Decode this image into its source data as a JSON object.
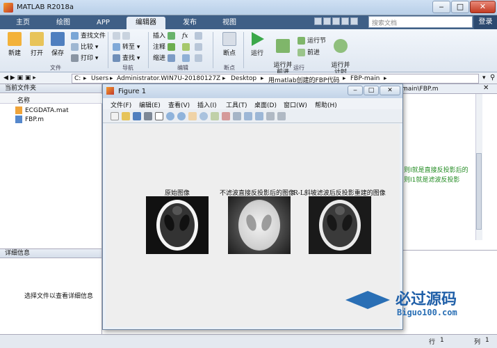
{
  "window": {
    "title": "MATLAB R2018a"
  },
  "tabs": [
    "主页",
    "绘图",
    "APP",
    "编辑器",
    "发布",
    "视图"
  ],
  "active_tab": "编辑器",
  "search": {
    "placeholder": "搜索文档"
  },
  "login_label": "登录",
  "ribbon": {
    "file": {
      "new": "新建",
      "open": "打开",
      "save": "保存",
      "find_files": "查找文件",
      "compare": "比较",
      "print": "打印",
      "group": "文件"
    },
    "nav": {
      "goto": "转至",
      "find": "查找",
      "group": "导航"
    },
    "edit": {
      "insert": "插入",
      "comment": "注释",
      "indent": "缩进",
      "fx": "fx",
      "group": "编辑"
    },
    "breakpoints": {
      "label": "断点",
      "group": "断点"
    },
    "run": {
      "run": "运行",
      "run_advance": "运行并\n前进",
      "run_section": "运行节",
      "advance": "前进",
      "run_time": "运行并\n计时",
      "group": "运行"
    }
  },
  "address": {
    "crumbs": [
      "C:",
      "Users",
      "Administrator.WIN7U-20180127Z",
      "Desktop",
      "用matlab创建的FBP代码",
      "FBP-main"
    ]
  },
  "current_folder": {
    "title": "当前文件夹",
    "column": "名称",
    "files": [
      "ECGDATA.mat",
      "FBP.m"
    ]
  },
  "details": {
    "title": "详细信息",
    "hint": "选择文件以查看详细信息"
  },
  "editor": {
    "tab_label": "main\\FBP.m",
    "lines": [
      "则I就是直接反投影后的",
      "则I1就是滤波反投影"
    ]
  },
  "status": {
    "row_label": "行",
    "row": "1",
    "col_label": "列",
    "col": "1"
  },
  "figure": {
    "title": "Figure 1",
    "menu": [
      "文件(F)",
      "编辑(E)",
      "查看(V)",
      "插入(I)",
      "工具(T)",
      "桌面(D)",
      "窗口(W)",
      "帮助(H)"
    ],
    "plots": [
      {
        "title": "原始图像"
      },
      {
        "title": "不滤波直接反投影后的图像"
      },
      {
        "title": "R-L斜坡滤波后反投影重建的图像"
      }
    ]
  },
  "watermark": {
    "cn": "必过源码",
    "url": "Biguo100.com"
  }
}
